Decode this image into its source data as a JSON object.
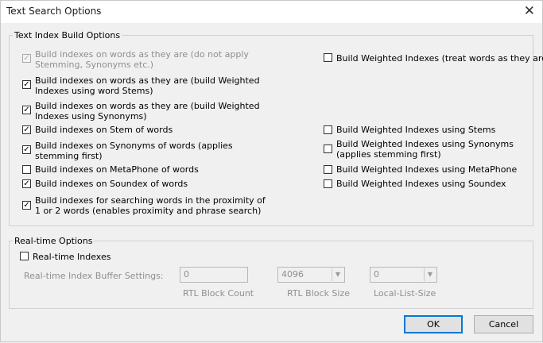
{
  "window": {
    "title": "Text Search Options",
    "close_glyph": "✕"
  },
  "index_group": {
    "legend": "Text Index Build Options",
    "left": [
      {
        "label": "Build indexes on words as they are (do not apply\nStemming, Synonyms etc.)",
        "checked": true,
        "disabled": true
      },
      {
        "label": "Build indexes on words as they are (build Weighted\nIndexes using word Stems)",
        "checked": true,
        "disabled": false
      },
      {
        "label": "Build indexes on words as they are (build Weighted\nIndexes using Synonyms)",
        "checked": true,
        "disabled": false
      },
      {
        "label": "Build indexes on Stem of words",
        "checked": true,
        "disabled": false
      },
      {
        "label": "Build indexes on Synonyms of words (applies\nstemming first)",
        "checked": true,
        "disabled": false
      },
      {
        "label": "Build indexes on MetaPhone of words",
        "checked": false,
        "disabled": false
      },
      {
        "label": "Build indexes on Soundex of words",
        "checked": true,
        "disabled": false
      },
      {
        "label": "Build indexes for searching words in the proximity of\n1 or 2 words (enables proximity and phrase search)",
        "checked": true,
        "disabled": false
      }
    ],
    "right": [
      {
        "label": "Build Weighted Indexes (treat words as they are)",
        "checked": false
      },
      {
        "label": "Build Weighted Indexes using Stems",
        "checked": false
      },
      {
        "label": "Build Weighted Indexes using Synonyms\n(applies stemming first)",
        "checked": false
      },
      {
        "label": "Build Weighted Indexes using MetaPhone",
        "checked": false
      },
      {
        "label": "Build Weighted Indexes using Soundex",
        "checked": false
      }
    ]
  },
  "realtime_group": {
    "legend": "Real-time Options",
    "realtime_label": "Real-time Indexes",
    "realtime_checked": false,
    "buffer_label": "Real-time Index Buffer Settings:",
    "rtl_block_count_value": "0",
    "rtl_block_count_caption": "RTL Block Count",
    "rtl_block_size_value": "4096",
    "rtl_block_size_caption": "RTL Block Size",
    "local_list_size_value": "0",
    "local_list_size_caption": "Local-List-Size",
    "arrow_glyph": "▼"
  },
  "buttons": {
    "ok": "OK",
    "cancel": "Cancel"
  },
  "colors": {
    "disabled_text": "#8f8f8f",
    "default_button_border": "#0078d7"
  }
}
